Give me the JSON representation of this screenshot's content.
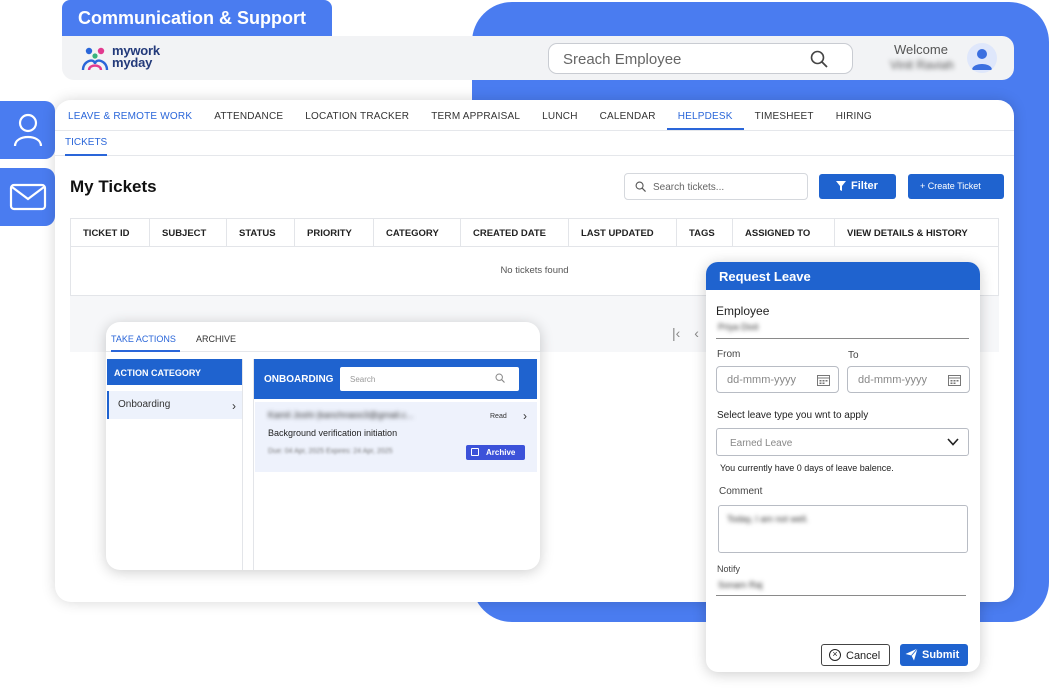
{
  "header": {
    "section_title": "Communication & Support",
    "logo_line1": "mywork",
    "logo_line2": "myday",
    "search_placeholder": "Sreach Employee",
    "welcome": "Welcome",
    "user_name": "Vinit Raviah"
  },
  "nav": {
    "items": [
      {
        "label": "LEAVE & REMOTE WORK"
      },
      {
        "label": "ATTENDANCE"
      },
      {
        "label": "LOCATION TRACKER"
      },
      {
        "label": "TERM APPRAISAL"
      },
      {
        "label": "LUNCH"
      },
      {
        "label": "CALENDAR"
      },
      {
        "label": "HELPDESK"
      },
      {
        "label": "TIMESHEET"
      },
      {
        "label": "HIRING"
      }
    ],
    "active": "HELPDESK",
    "sub_tab": "TICKETS"
  },
  "tickets": {
    "title": "My Tickets",
    "search_placeholder": "Search tickets...",
    "filter_label": "Filter",
    "create_label": "+ Create Ticket",
    "columns": [
      "TICKET ID",
      "SUBJECT",
      "STATUS",
      "PRIORITY",
      "CATEGORY",
      "CREATED DATE",
      "LAST UPDATED",
      "TAGS",
      "ASSIGNED TO",
      "VIEW DETAILS & HISTORY"
    ],
    "empty_message": "No tickets found"
  },
  "actions": {
    "tabs": [
      "TAKE ACTIONS",
      "ARCHIVE"
    ],
    "category_header": "ACTION CATEGORY",
    "category_item": "Onboarding",
    "list_header": "ONBOARDING",
    "search_placeholder": "Search",
    "card": {
      "email": "Kamil Joshi (kanchnaoo3@gmail.c...",
      "status": "Read",
      "subject": "Background verification initiation",
      "dates": "Due: 04 Apr, 2025   Expires: 24 Apr, 2025",
      "archive_label": "Archive"
    }
  },
  "leave": {
    "title": "Request Leave",
    "employee_label": "Employee",
    "employee_value": "Priya Dixit",
    "from_label": "From",
    "to_label": "To",
    "date_placeholder": "dd-mmm-yyyy",
    "type_label": "Select leave type you wnt to apply",
    "type_value": "Earned Leave",
    "balance_note": "You currently have 0 days of leave balence.",
    "comment_label": "Comment",
    "comment_value": "Today, I am not well.",
    "notify_label": "Notify",
    "notify_value": "Sonam Raj",
    "cancel_label": "Cancel",
    "submit_label": "Submit"
  },
  "colors": {
    "primary": "#1f63cf",
    "accent_bg": "#4a7cf0",
    "link": "#2a66d9"
  }
}
